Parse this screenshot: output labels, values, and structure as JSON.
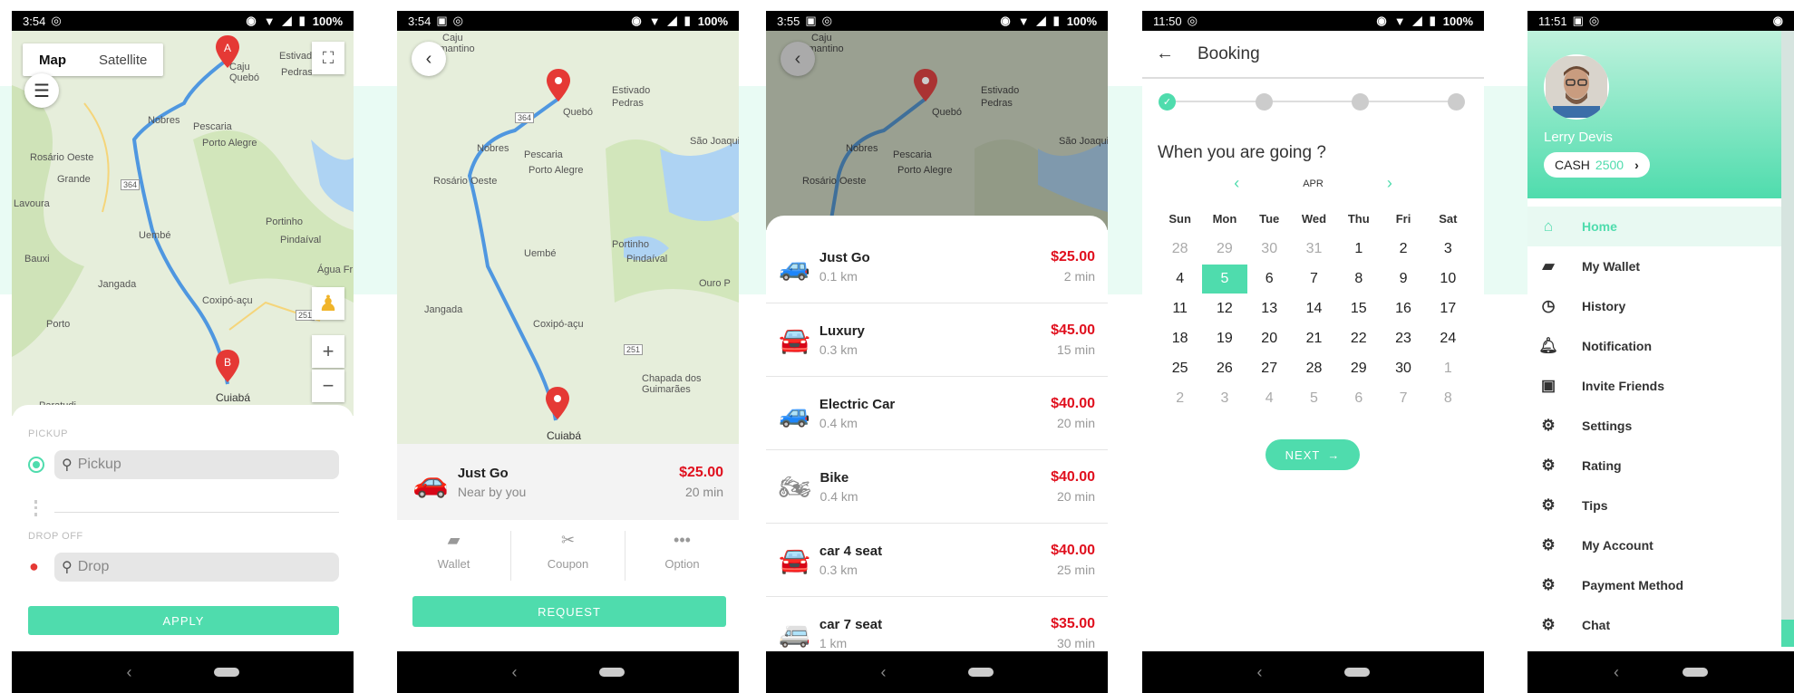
{
  "screens": {
    "s1": {
      "time": "3:54",
      "battery": "100%",
      "map_type_map": "Map",
      "map_type_satellite": "Satellite",
      "pin_a": "A",
      "pin_b": "B",
      "places": [
        "Caju",
        "Quebó",
        "Estivado",
        "Nobres",
        "Pescaria",
        "Rosário Oeste",
        "Porto Alegre",
        "Lavoura",
        "Grande",
        "Bauxi",
        "Uembé",
        "Jangada",
        "Porto",
        "Coxipó-açu",
        "Paratudi",
        "Cuiabá",
        "Pedras",
        "Portinho",
        "Água Fr",
        "Pindaíval",
        "364",
        "251"
      ],
      "pickup_label": "PICKUP",
      "pickup_placeholder": "Pickup",
      "dropoff_label": "DROP OFF",
      "drop_placeholder": "Drop",
      "apply": "APPLY"
    },
    "s2": {
      "time": "3:54",
      "battery": "100%",
      "places": [
        "Caju",
        "Diamantino",
        "Quebó",
        "Estivado",
        "Pedras",
        "São Joaqui",
        "Nobres",
        "Pescaria",
        "Rosário Oeste",
        "Porto Alegre",
        "Portinho",
        "Pindaíval",
        "Jangada",
        "Ouro P",
        "Coxipó-açu",
        "Chapada dos",
        "Guimarães",
        "Cuiabá",
        "364",
        "251",
        "Uembé"
      ],
      "vehicle_name": "Just Go",
      "vehicle_sub": "Near by you",
      "vehicle_price": "$25.00",
      "vehicle_time": "20 min",
      "actions": [
        {
          "label": "Wallet",
          "icon": "wallet-icon"
        },
        {
          "label": "Coupon",
          "icon": "coupon-icon"
        },
        {
          "label": "Option",
          "icon": "more-icon"
        }
      ],
      "request": "REQUEST"
    },
    "s3": {
      "time": "3:55",
      "battery": "100%",
      "places": [
        "Caju",
        "Diamantino",
        "Quebó",
        "Estivado",
        "Pedras",
        "Nobres",
        "Pescaria",
        "Rosário Oeste",
        "Porto Alegre",
        "São Joaqui"
      ],
      "vehicles": [
        {
          "name": "Just Go",
          "dist": "0.1 km",
          "price": "$25.00",
          "time": "2 min",
          "icon": "car-icon"
        },
        {
          "name": "Luxury",
          "dist": "0.3 km",
          "price": "$45.00",
          "time": "15 min",
          "icon": "car-outline-icon"
        },
        {
          "name": "Electric Car",
          "dist": "0.4 km",
          "price": "$40.00",
          "time": "20 min",
          "icon": "car-icon"
        },
        {
          "name": "Bike",
          "dist": "0.4 km",
          "price": "$40.00",
          "time": "20 min",
          "icon": "bike-icon"
        },
        {
          "name": "car 4 seat",
          "dist": "0.3 km",
          "price": "$40.00",
          "time": "25 min",
          "icon": "car-outline-icon"
        },
        {
          "name": "car 7 seat",
          "dist": "1 km",
          "price": "$35.00",
          "time": "30 min",
          "icon": "van-icon"
        }
      ]
    },
    "s4": {
      "time": "11:50",
      "battery": "100%",
      "title": "Booking",
      "question": "When you are going ?",
      "month": "APR",
      "weekdays": [
        "Sun",
        "Mon",
        "Tue",
        "Wed",
        "Thu",
        "Fri",
        "Sat"
      ],
      "weeks": [
        [
          "28",
          "29",
          "30",
          "31",
          "1",
          "2",
          "3"
        ],
        [
          "4",
          "5",
          "6",
          "7",
          "8",
          "9",
          "10"
        ],
        [
          "11",
          "12",
          "13",
          "14",
          "15",
          "16",
          "17"
        ],
        [
          "18",
          "19",
          "20",
          "21",
          "22",
          "23",
          "24"
        ],
        [
          "25",
          "26",
          "27",
          "28",
          "29",
          "30",
          "1"
        ],
        [
          "2",
          "3",
          "4",
          "5",
          "6",
          "7",
          "8"
        ]
      ],
      "selected_day": "5",
      "next": "NEXT"
    },
    "s5": {
      "time": "11:51",
      "user_name": "Lerry Devis",
      "cash_label": "CASH",
      "cash_value": "2500",
      "menu": [
        {
          "label": "Home",
          "icon": "home-icon"
        },
        {
          "label": "My Wallet",
          "icon": "wallet-icon"
        },
        {
          "label": "History",
          "icon": "clock-icon"
        },
        {
          "label": "Notification",
          "icon": "bell-icon"
        },
        {
          "label": "Invite Friends",
          "icon": "gift-icon"
        },
        {
          "label": "Settings",
          "icon": "gear-icon"
        },
        {
          "label": "Rating",
          "icon": "gear-icon"
        },
        {
          "label": "Tips",
          "icon": "gear-icon"
        },
        {
          "label": "My Account",
          "icon": "gear-icon"
        },
        {
          "label": "Payment Method",
          "icon": "gear-icon"
        },
        {
          "label": "Chat",
          "icon": "gear-icon"
        }
      ]
    }
  },
  "colors": {
    "accent": "#4fdcad",
    "price": "#e0101e",
    "route": "#4f97e0",
    "map_bg": "#e6eedb",
    "mint_bg": "#e9fbf4"
  }
}
